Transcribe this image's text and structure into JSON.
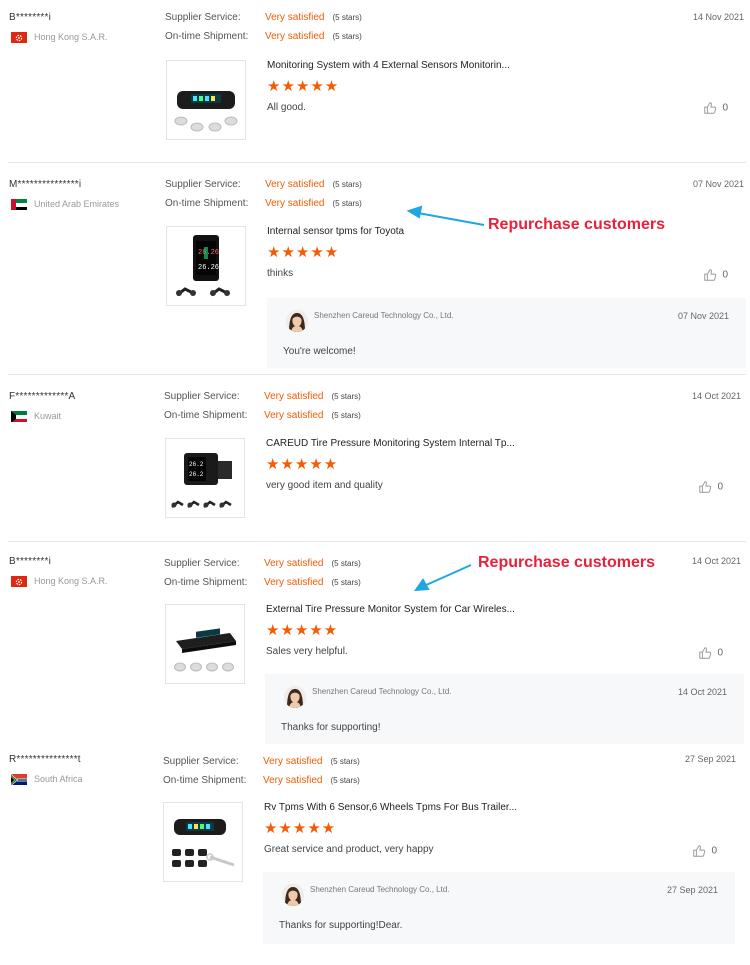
{
  "labels": {
    "supplier_service": "Supplier Service:",
    "ontime_shipment": "On-time Shipment:"
  },
  "colors": {
    "accent": "#f25c05",
    "callout": "#e8213b",
    "arrow": "#1ea7e1"
  },
  "reviews": [
    {
      "buyer": "B********i",
      "country": "Hong Kong S.A.R.",
      "flag": "hong-kong",
      "date": "14 Nov 2021",
      "supplier_service": "Very satisfied",
      "supplier_service_stars": "(5 stars)",
      "ontime_shipment": "Very satisfied",
      "ontime_shipment_stars": "(5 stars)",
      "product_title": "Monitoring System with 4 External Sensors Monitorin...",
      "stars": "★★★★★",
      "rating": 5,
      "comment": "All good.",
      "likes": "0"
    },
    {
      "buyer": "M***************i",
      "country": "United Arab Emirates",
      "flag": "uae",
      "date": "07 Nov 2021",
      "supplier_service": "Very satisfied",
      "supplier_service_stars": "(5 stars)",
      "ontime_shipment": "Very satisfied",
      "ontime_shipment_stars": "(5 stars)",
      "product_title": "Internal sensor tpms for Toyota",
      "stars": "★★★★★",
      "rating": 5,
      "comment": "thinks",
      "likes": "0",
      "reply": {
        "seller": "Shenzhen Careud Technology Co., Ltd.",
        "date": "07 Nov 2021",
        "text": "You're welcome!"
      }
    },
    {
      "buyer": "F*************A",
      "country": "Kuwait",
      "flag": "kuwait",
      "date": "14 Oct 2021",
      "supplier_service": "Very satisfied",
      "supplier_service_stars": "(5 stars)",
      "ontime_shipment": "Very satisfied",
      "ontime_shipment_stars": "(5 stars)",
      "product_title": "CAREUD Tire Pressure Monitoring System Internal Tp...",
      "stars": "★★★★★",
      "rating": 5,
      "comment": "very good item and quality",
      "likes": "0"
    },
    {
      "buyer": "B********i",
      "country": "Hong Kong S.A.R.",
      "flag": "hong-kong",
      "date": "14 Oct 2021",
      "supplier_service": "Very satisfied",
      "supplier_service_stars": "(5 stars)",
      "ontime_shipment": "Very satisfied",
      "ontime_shipment_stars": "(5 stars)",
      "product_title": "External Tire Pressure Monitor System for Car Wireles...",
      "stars": "★★★★★",
      "rating": 5,
      "comment": "Sales very helpful.",
      "likes": "0",
      "reply": {
        "seller": "Shenzhen Careud Technology Co., Ltd.",
        "date": "14 Oct 2021",
        "text": "Thanks for supporting!"
      }
    },
    {
      "buyer": "R***************t",
      "country": "South Africa",
      "flag": "south-africa",
      "date": "27 Sep 2021",
      "supplier_service": "Very satisfied",
      "supplier_service_stars": "(5 stars)",
      "ontime_shipment": "Very satisfied",
      "ontime_shipment_stars": "(5 stars)",
      "product_title": "Rv Tpms With 6 Sensor,6 Wheels Tpms For Bus Trailer...",
      "stars": "★★★★★",
      "rating": 5,
      "comment": "Great service and product, very happy",
      "likes": "0",
      "reply": {
        "seller": "Shenzhen Careud Technology Co., Ltd.",
        "date": "27 Sep 2021",
        "text": "Thanks for supporting!Dear."
      }
    }
  ],
  "callouts": [
    {
      "text": "Repurchase customers"
    },
    {
      "text": "Repurchase customers"
    }
  ]
}
